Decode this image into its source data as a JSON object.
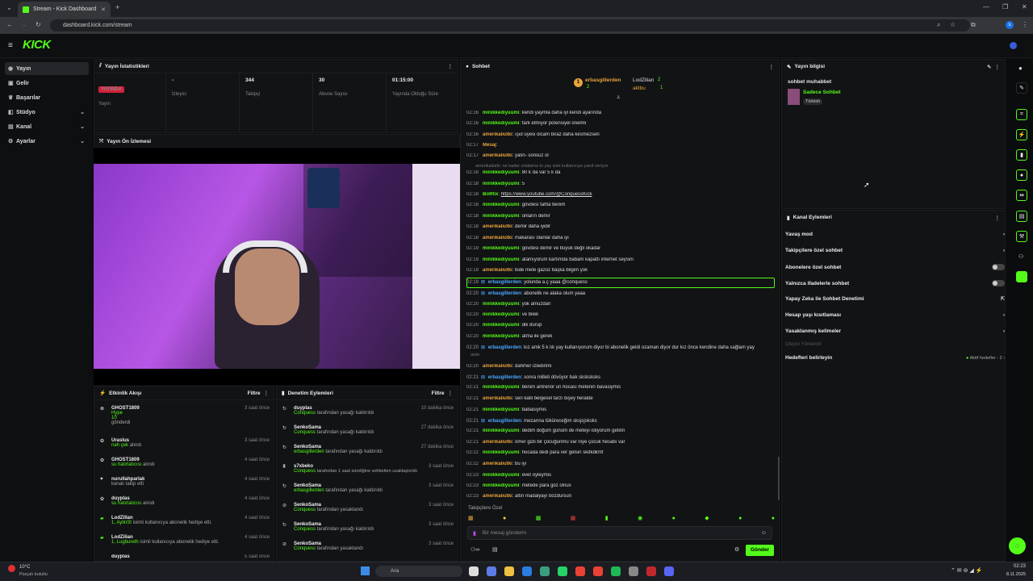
{
  "browser": {
    "tab_title": "Stream - Kick Dashboard",
    "url": "dashboard.kick.com/stream",
    "new_tab": "+",
    "profile_initial": "s"
  },
  "app": {
    "logo": "KICK"
  },
  "sidebar": {
    "items": [
      {
        "label": "Yayın"
      },
      {
        "label": "Gelir"
      },
      {
        "label": "Başarılar"
      },
      {
        "label": "Stüdyo"
      },
      {
        "label": "Kanal"
      },
      {
        "label": "Ayarlar"
      }
    ]
  },
  "stats": {
    "title": "Yayın İstatistikleri",
    "live_badge": "YAYINDA",
    "items": [
      {
        "value": "",
        "label": "Yayın"
      },
      {
        "value": "-",
        "label": "İzleyici"
      },
      {
        "value": "344",
        "label": "Takipçi"
      },
      {
        "value": "30",
        "label": "Abone Sayısı"
      },
      {
        "value": "01:15:00",
        "label": "Yayında Olduğu Süre"
      }
    ]
  },
  "preview": {
    "title": "Yayın Ön İzlemesi"
  },
  "activity": {
    "title": "Etkinlik Akışı",
    "filter": "Filtre",
    "items": [
      {
        "name": "GHOST1809",
        "sub": "Hype",
        "extra": "10",
        "extra2": "gönderdi",
        "time": "3 saat önce"
      },
      {
        "name": "Uraslus",
        "sub": "nah çek",
        "extra2": "alındı",
        "time": "3 saat önce"
      },
      {
        "name": "GHOST1809",
        "sub": "su hatırlatıcısı",
        "extra2": "alındı",
        "time": "4 saat önce"
      },
      {
        "name": "nurullahparlak",
        "sub": "",
        "extra2": "kanalı takip etti",
        "time": "4 saat önce"
      },
      {
        "name": "duyplas",
        "sub": "su hatırlatıcısı",
        "extra2": "alındı",
        "time": "4 saat önce"
      },
      {
        "name": "LodZilian",
        "sub": "1, AylinSt",
        "extra2": "isimli kullanıcıya abonelik hediye etti.",
        "time": "4 saat önce"
      },
      {
        "name": "LodZilian",
        "sub": "1, Lugbureth",
        "extra2": "isimli kullanıcıya abonelik hediye etti.",
        "time": "4 saat önce"
      },
      {
        "name": "duyplas",
        "sub": "",
        "extra2": "",
        "time": "5 saat önce"
      }
    ]
  },
  "moderation": {
    "title": "Denetim Eylemleri",
    "filter": "Filtre",
    "items": [
      {
        "name": "duyplas",
        "by": "Conquess",
        "action": "tarafından yasağı kaldırıldı",
        "time": "10 dakika önce"
      },
      {
        "name": "SenkoSama",
        "by": "Conquess",
        "action": "tarafından yasağı kaldırıldı",
        "time": "27 dakika önce"
      },
      {
        "name": "SenkoSama",
        "by": "erbasgillerden",
        "action": "tarafından yasağı kaldırıldı",
        "time": "27 dakika önce"
      },
      {
        "name": "s7xbeko",
        "by": "Conquess",
        "action": "tarafından 1 saat süreliğine sohbetten uzaklaştırıldı",
        "time": "3 saat önce"
      },
      {
        "name": "SenkoSama",
        "by": "erbasgillerden",
        "action": "tarafından yasağı kaldırıldı",
        "time": "3 saat önce"
      },
      {
        "name": "SenkoSama",
        "by": "Conquess",
        "action": "tarafından yasaklandı",
        "time": "3 saat önce"
      },
      {
        "name": "SenkoSama",
        "by": "Conquess",
        "action": "tarafından yasağı kaldırıldı",
        "time": "3 saat önce"
      },
      {
        "name": "SenkoSama",
        "by": "Conquess",
        "action": "tarafından yasaklandı",
        "time": "3 saat önce"
      }
    ]
  },
  "chat": {
    "title": "Sohbet",
    "top": {
      "u1": "erbasgillerden",
      "u1n": "2",
      "u2": "LodZilian",
      "u2n": "2",
      "u3": "aktbu",
      "u3n": "1"
    },
    "followers_only": "Takipçilere Özel",
    "placeholder": "Bir mesaj gönderin",
    "send": "Gönder",
    "messages": [
      {
        "t": "02:16",
        "u": "minikkediyuumi",
        "c": "g",
        "m": "kendi yaymla daha iyi kendi ayarında"
      },
      {
        "t": "02:16",
        "u": "minikkediyuumi",
        "c": "g",
        "m": "fark etmiyor potensiyel önemli"
      },
      {
        "t": "02:16",
        "u": "amerikaliutki",
        "c": "o",
        "m": "ışıd üyesi olcam biraz daha kesmezsen"
      },
      {
        "t": "02:17",
        "u": "Mesaj",
        "c": "o",
        "m": ""
      },
      {
        "t": "02:17",
        "u": "amerikaliutki",
        "c": "o",
        "m": "yalın- sonsuz ol"
      },
      {
        "t": "",
        "u": "",
        "c": "",
        "m": "amerikaliutki: ne kadar ortalama to yay ismi kullanıcıya yand veriyor"
      },
      {
        "t": "02:18",
        "u": "minikkediyuumi",
        "c": "g",
        "m": "80 k da var 5 k da"
      },
      {
        "t": "02:18",
        "u": "minikkediyuumi",
        "c": "g",
        "m": "5"
      },
      {
        "t": "02:18",
        "u": "BotRix",
        "c": "g",
        "m": "https://www.youtube.com/@ConquessKick"
      },
      {
        "t": "02:18",
        "u": "minikkediyuumi",
        "c": "g",
        "m": "gövdesi tahta benim"
      },
      {
        "t": "02:18",
        "u": "minikkediyuumi",
        "c": "g",
        "m": "onların demir"
      },
      {
        "t": "02:18",
        "u": "amerikaliutki",
        "c": "o",
        "m": "demir daha iyidir"
      },
      {
        "t": "02:18",
        "u": "amerikaliutki",
        "c": "o",
        "m": "makarası olanlar daha iyi"
      },
      {
        "t": "02:19",
        "u": "minikkediyuumi",
        "c": "g",
        "m": "gövdesi demir ve büyük değil okadar"
      },
      {
        "t": "02:19",
        "u": "minikkediyuumi",
        "c": "g",
        "m": "atamıyorum kartımda babam kapattı internet seysini"
      },
      {
        "t": "02:19",
        "u": "amerikaliutki",
        "c": "o",
        "m": "bide mete gazoz başka bilgim yok"
      },
      {
        "t": "02:19",
        "u": "erbasgillerden",
        "c": "b",
        "m": "yolunda a.ç yaaa @conquess"
      },
      {
        "t": "02:20",
        "u": "erbasgillerden",
        "c": "b",
        "m": "abonelik ne alaka olum yaaa"
      },
      {
        "t": "02:20",
        "u": "minikkediyuumi",
        "c": "g",
        "m": "yok amuzdan"
      },
      {
        "t": "02:20",
        "u": "minikkediyuumi",
        "c": "g",
        "m": "ve bilek"
      },
      {
        "t": "02:20",
        "u": "minikkediyuumi",
        "c": "g",
        "m": "dik durup"
      },
      {
        "t": "02:20",
        "u": "minikkediyuumi",
        "c": "g",
        "m": "atma ile gerek"
      },
      {
        "t": "02:20",
        "u": "erbasgillerden",
        "c": "b",
        "m": "kız amk 5 k lık yay kullanıyorum diyor bi abonelik geldi ozaman diyor dur kız önce kendine daha sağlam yay"
      },
      {
        "t": "",
        "u": "",
        "c": "",
        "m": "aisin"
      },
      {
        "t": "02:20",
        "u": "amerikaliutki",
        "c": "o",
        "m": "dahmer izledinmi"
      },
      {
        "t": "02:21",
        "u": "erbasgillerden",
        "c": "b",
        "m": "sonra milleti dövüyor bak sksksksks"
      },
      {
        "t": "02:21",
        "u": "minikkediyuumi",
        "c": "g",
        "m": "benim antrenör un hocası metenin bavasiymis"
      },
      {
        "t": "02:21",
        "u": "amerikaliutki",
        "c": "o",
        "m": "seri katil belgesel tarzı bişey heralde"
      },
      {
        "t": "02:21",
        "u": "minikkediyuumi",
        "c": "g",
        "m": "babasıymis"
      },
      {
        "t": "02:21",
        "u": "erbasgillerden",
        "c": "b",
        "m": "mezarına tüküreceğim sksjsjsksks"
      },
      {
        "t": "02:21",
        "u": "minikkediyuumi",
        "c": "g",
        "m": "dedim doğum günüm de meteyi istiyorum getirin"
      },
      {
        "t": "02:21",
        "u": "amerikaliutki",
        "c": "o",
        "m": "ömer gizli bir çocuğunmu var niye çocuk hesabı var"
      },
      {
        "t": "02:22",
        "u": "minikkediyuumi",
        "c": "g",
        "m": "hocada dedi para ver gelsin skdkdkmf"
      },
      {
        "t": "02:22",
        "u": "amerikaliutki",
        "c": "o",
        "m": "bu iyi"
      },
      {
        "t": "02:23",
        "u": "minikkediyuumi",
        "c": "g",
        "m": "evet oyleymis"
      },
      {
        "t": "02:23",
        "u": "minikkediyuumi",
        "c": "g",
        "m": "metede para göz olnus"
      },
      {
        "t": "02:23",
        "u": "amerikaliutki",
        "c": "o",
        "m": "altın madalyayı bozdursun"
      }
    ]
  },
  "info": {
    "title": "Yayın bilgisi",
    "stream_title": "sohbet muhabbet",
    "category": "Sadece Sohbet",
    "tag": "Türkish"
  },
  "actions": {
    "title": "Kanal Eylemleri",
    "items": [
      {
        "label": "Yavaş mod",
        "ctrl": "chev"
      },
      {
        "label": "Takipçilere özel sohbet",
        "ctrl": "chev"
      },
      {
        "label": "Abonelere özel sohbet",
        "ctrl": "toggle"
      },
      {
        "label": "Yalnızca ifadelerle sohbet",
        "ctrl": "toggle"
      },
      {
        "label": "Yapay Zeka ile Sohbet Denetimi",
        "ctrl": "ext"
      },
      {
        "label": "Hesap yaşı kısıtlaması",
        "ctrl": "chev"
      },
      {
        "label": "Yasaklanmış kelimeler",
        "ctrl": "chev"
      }
    ],
    "section": "İzleyici Yönlendir",
    "goals_label": "Hedefleri belirleyin",
    "goals_status": "Aktif hedefler - 2"
  },
  "taskbar": {
    "weather_temp": "10°C",
    "weather_desc": "Parçalı bulutlu",
    "search": "Ara",
    "time": "02:23",
    "date": "8.11.2025"
  }
}
